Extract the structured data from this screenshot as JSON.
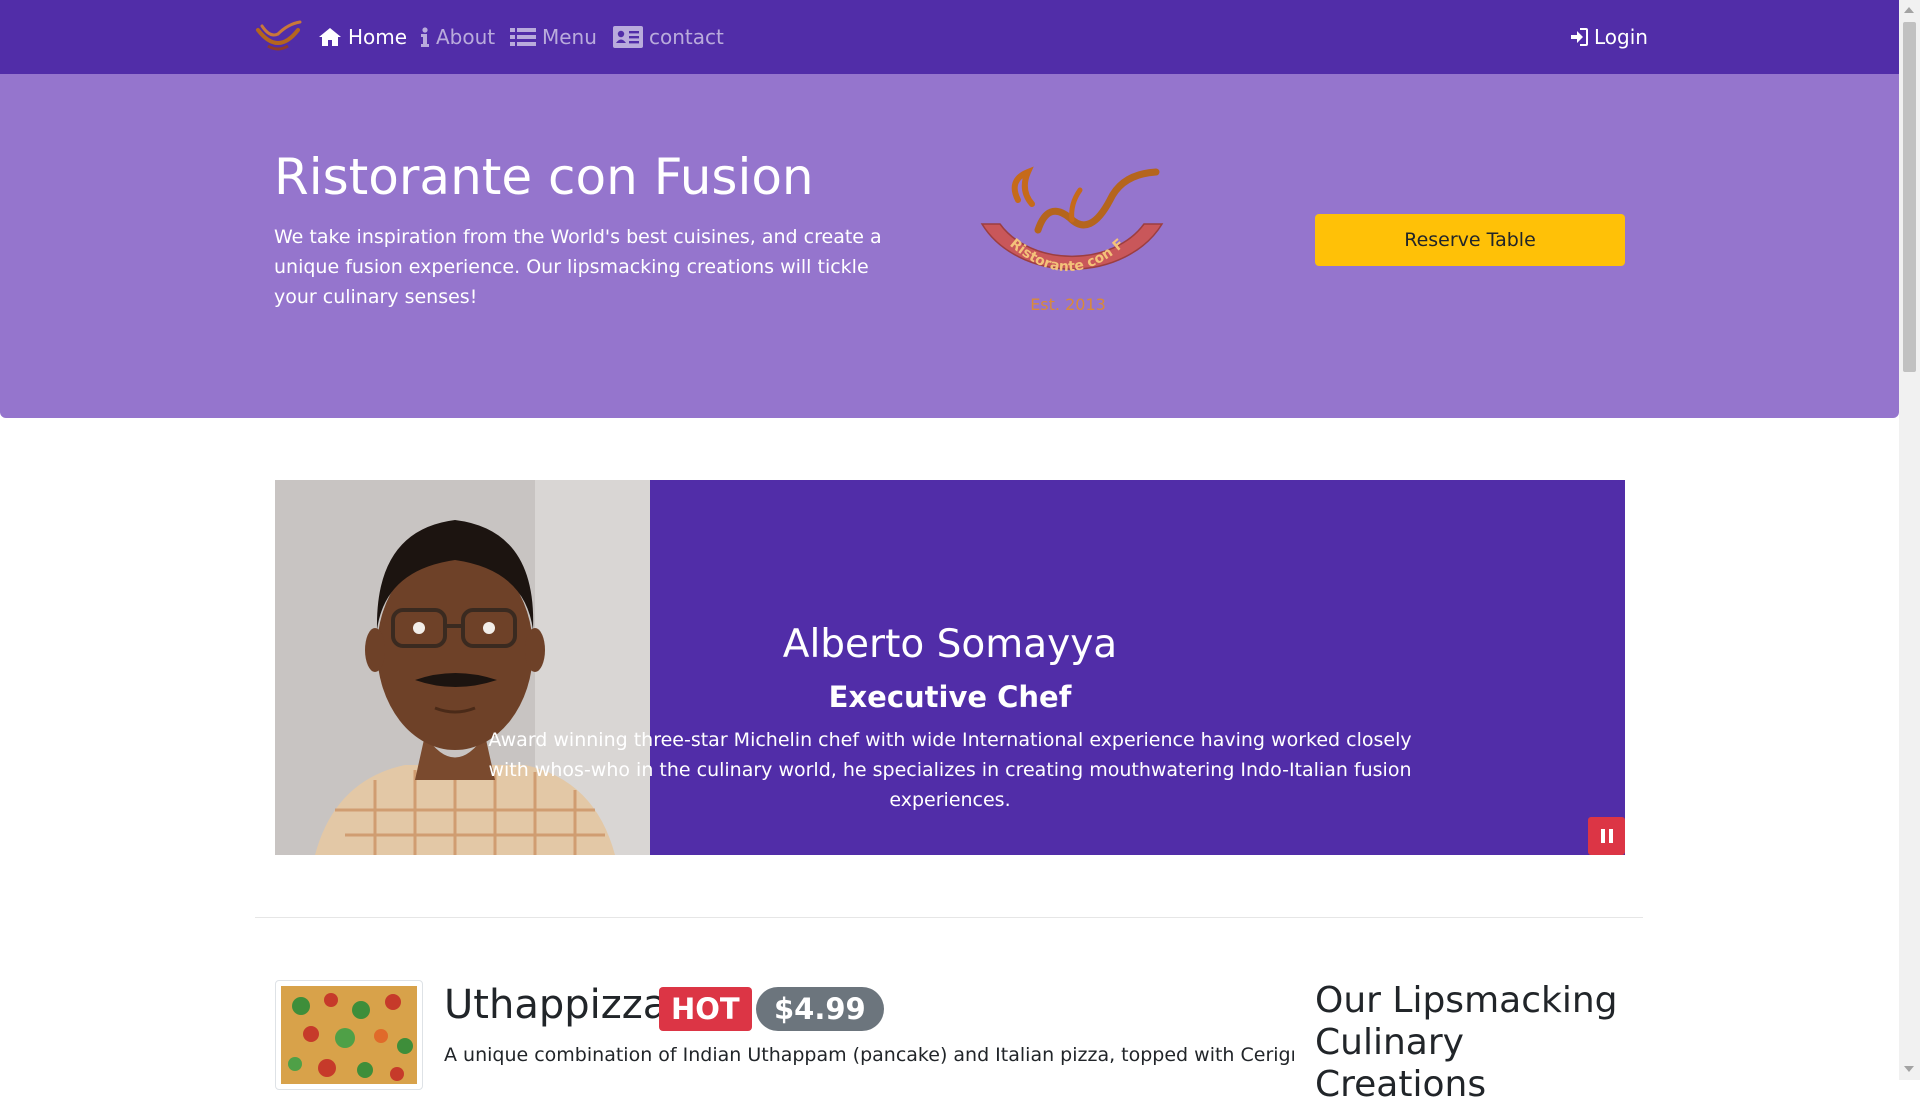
{
  "navbar": {
    "brand_icon": "restaurant-logo",
    "items": [
      {
        "label": "Home",
        "icon": "home-icon",
        "active": true
      },
      {
        "label": "About",
        "icon": "info-icon",
        "active": false
      },
      {
        "label": "Menu",
        "icon": "list-icon",
        "active": false
      },
      {
        "label": "contact",
        "icon": "address-card-icon",
        "active": false
      }
    ],
    "login_label": "Login",
    "login_icon": "sign-in-icon"
  },
  "jumbotron": {
    "title": "Ristorante con Fusion",
    "text": "We take inspiration from the World's best cuisines, and create a unique fusion experience. Our lipsmacking creations will tickle your culinary senses!",
    "logo_text": "Ristorante con Fusion",
    "logo_est": "Est. 2013",
    "reserve_label": "Reserve Table"
  },
  "carousel": {
    "name": "Alberto Somayya",
    "role": "Executive Chef",
    "description": "Award winning three-star Michelin chef with wide International experience having worked closely with whos-who in the culinary world, he specializes in creating mouthwatering Indo-Italian fusion experiences.",
    "pause_icon": "pause-icon"
  },
  "dish": {
    "name": "Uthappizza",
    "badge": "HOT",
    "price": "$4.99",
    "description": "A unique combination of Indian Uthappam (pancake) and Italian pizza, topped with Cerignola"
  },
  "side": {
    "heading": "Our Lipsmacking Culinary Creations"
  },
  "colors": {
    "primary": "#512DA8",
    "jumbotron": "#9575CD",
    "warning": "#FFC107",
    "danger": "#DC3545",
    "secondary": "#6C757D"
  }
}
